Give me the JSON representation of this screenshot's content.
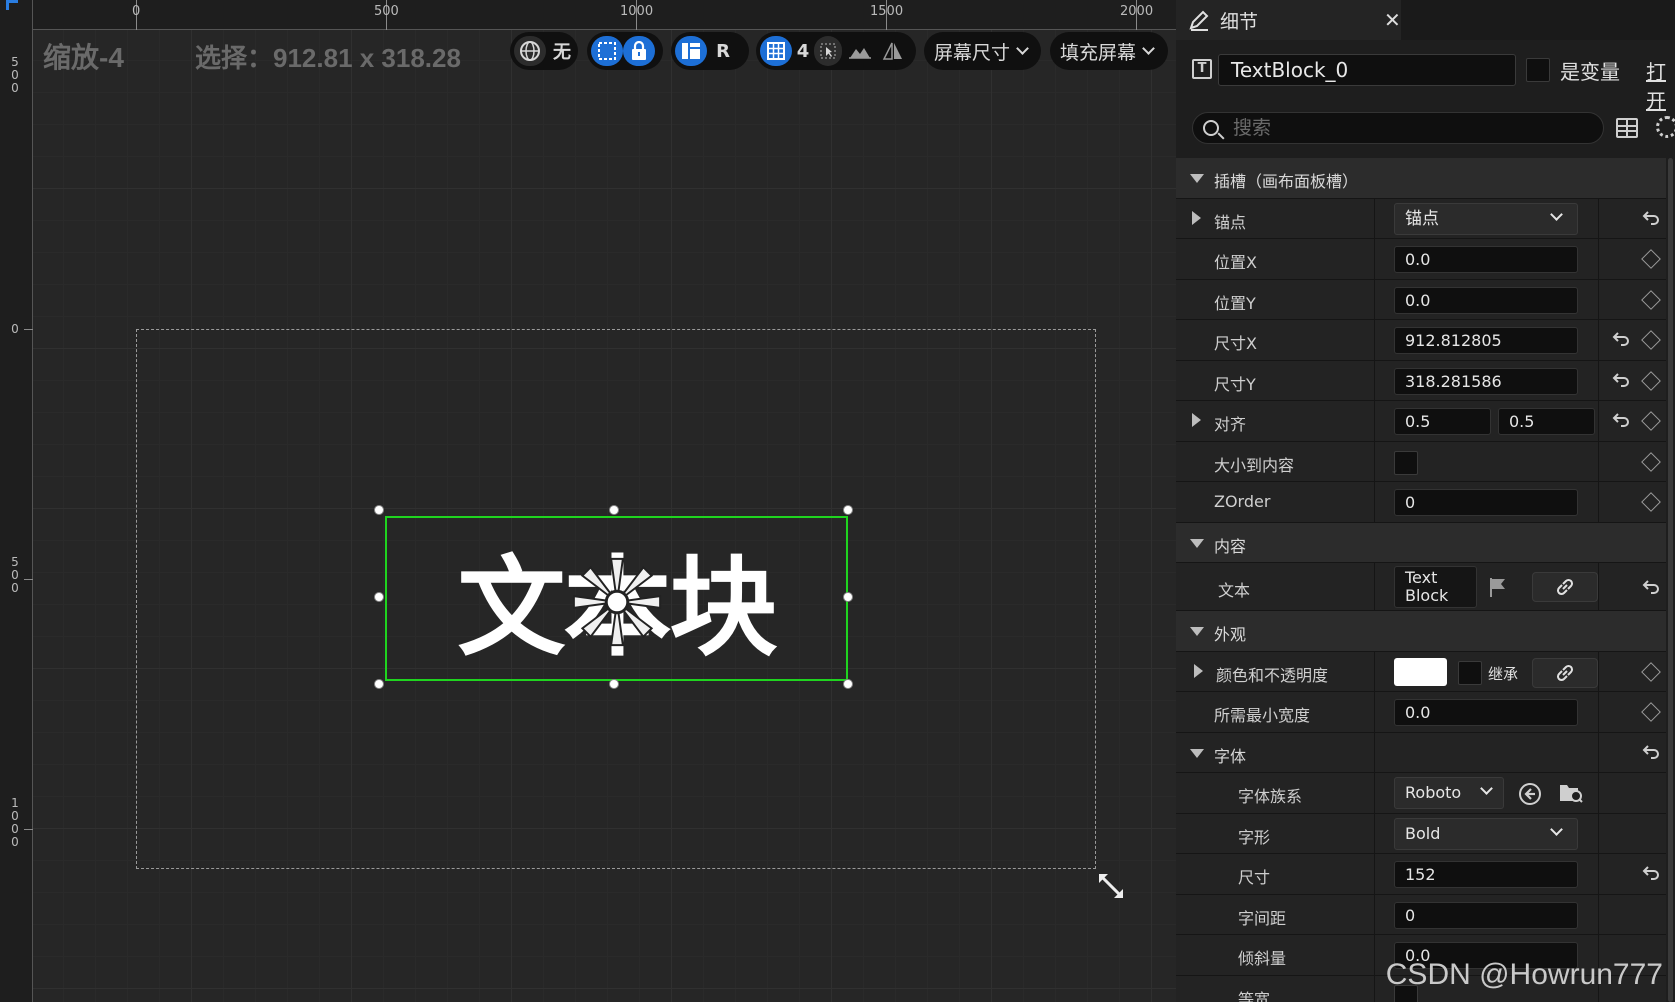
{
  "viewport": {
    "zoom_label": "缩放-4",
    "selection_label": "选择：912.81 x 318.28",
    "ruler_top": [
      "0",
      "500",
      "1000",
      "1500",
      "2000"
    ],
    "ruler_left": [
      [
        "5",
        "0",
        "0"
      ],
      [
        "0"
      ],
      [
        "5",
        "0",
        "0"
      ],
      [
        "1",
        "0",
        "0",
        "0"
      ]
    ],
    "toolbar": {
      "world_label": "无",
      "r_label": "R",
      "grid_count": "4",
      "screen_size_label": "屏幕尺寸",
      "fill_screen_label": "填充屏幕"
    },
    "textblock_text": "文本块"
  },
  "details": {
    "tab_title": "细节",
    "widget_name": "TextBlock_0",
    "is_variable_label": "是变量",
    "open_label": "打开",
    "search_placeholder": "搜索",
    "slot_section": "插槽（画布面板槽）",
    "rows": {
      "anchor_label": "锚点",
      "anchor_value": "锚点",
      "pos_x_label": "位置X",
      "pos_x_value": "0.0",
      "pos_y_label": "位置Y",
      "pos_y_value": "0.0",
      "size_x_label": "尺寸X",
      "size_x_value": "912.812805",
      "size_y_label": "尺寸Y",
      "size_y_value": "318.281586",
      "align_label": "对齐",
      "align_x_value": "0.5",
      "align_y_value": "0.5",
      "size_to_content_label": "大小到内容",
      "zorder_label": "ZOrder",
      "zorder_value": "0"
    },
    "content_section": "内容",
    "text_label": "文本",
    "text_value_line1": "Text",
    "text_value_line2": "Block",
    "appearance_section": "外观",
    "color_label": "颜色和不透明度",
    "color_value": "#ffffff",
    "inherit_label": "继承",
    "min_width_label": "所需最小宽度",
    "min_width_value": "0.0",
    "font_section": "字体",
    "font_family_label": "字体族系",
    "font_family_value": "Roboto",
    "typeface_label": "字形",
    "typeface_value": "Bold",
    "font_size_label": "尺寸",
    "font_size_value": "152",
    "letter_spacing_label": "字间距",
    "letter_spacing_value": "0",
    "skew_label": "倾斜量",
    "skew_value": "0.0",
    "monospace_label": "等宽"
  },
  "watermark": "CSDN @Howrun777",
  "colors": {
    "accent": "#1d6fd6",
    "selection": "#1fd41f"
  }
}
